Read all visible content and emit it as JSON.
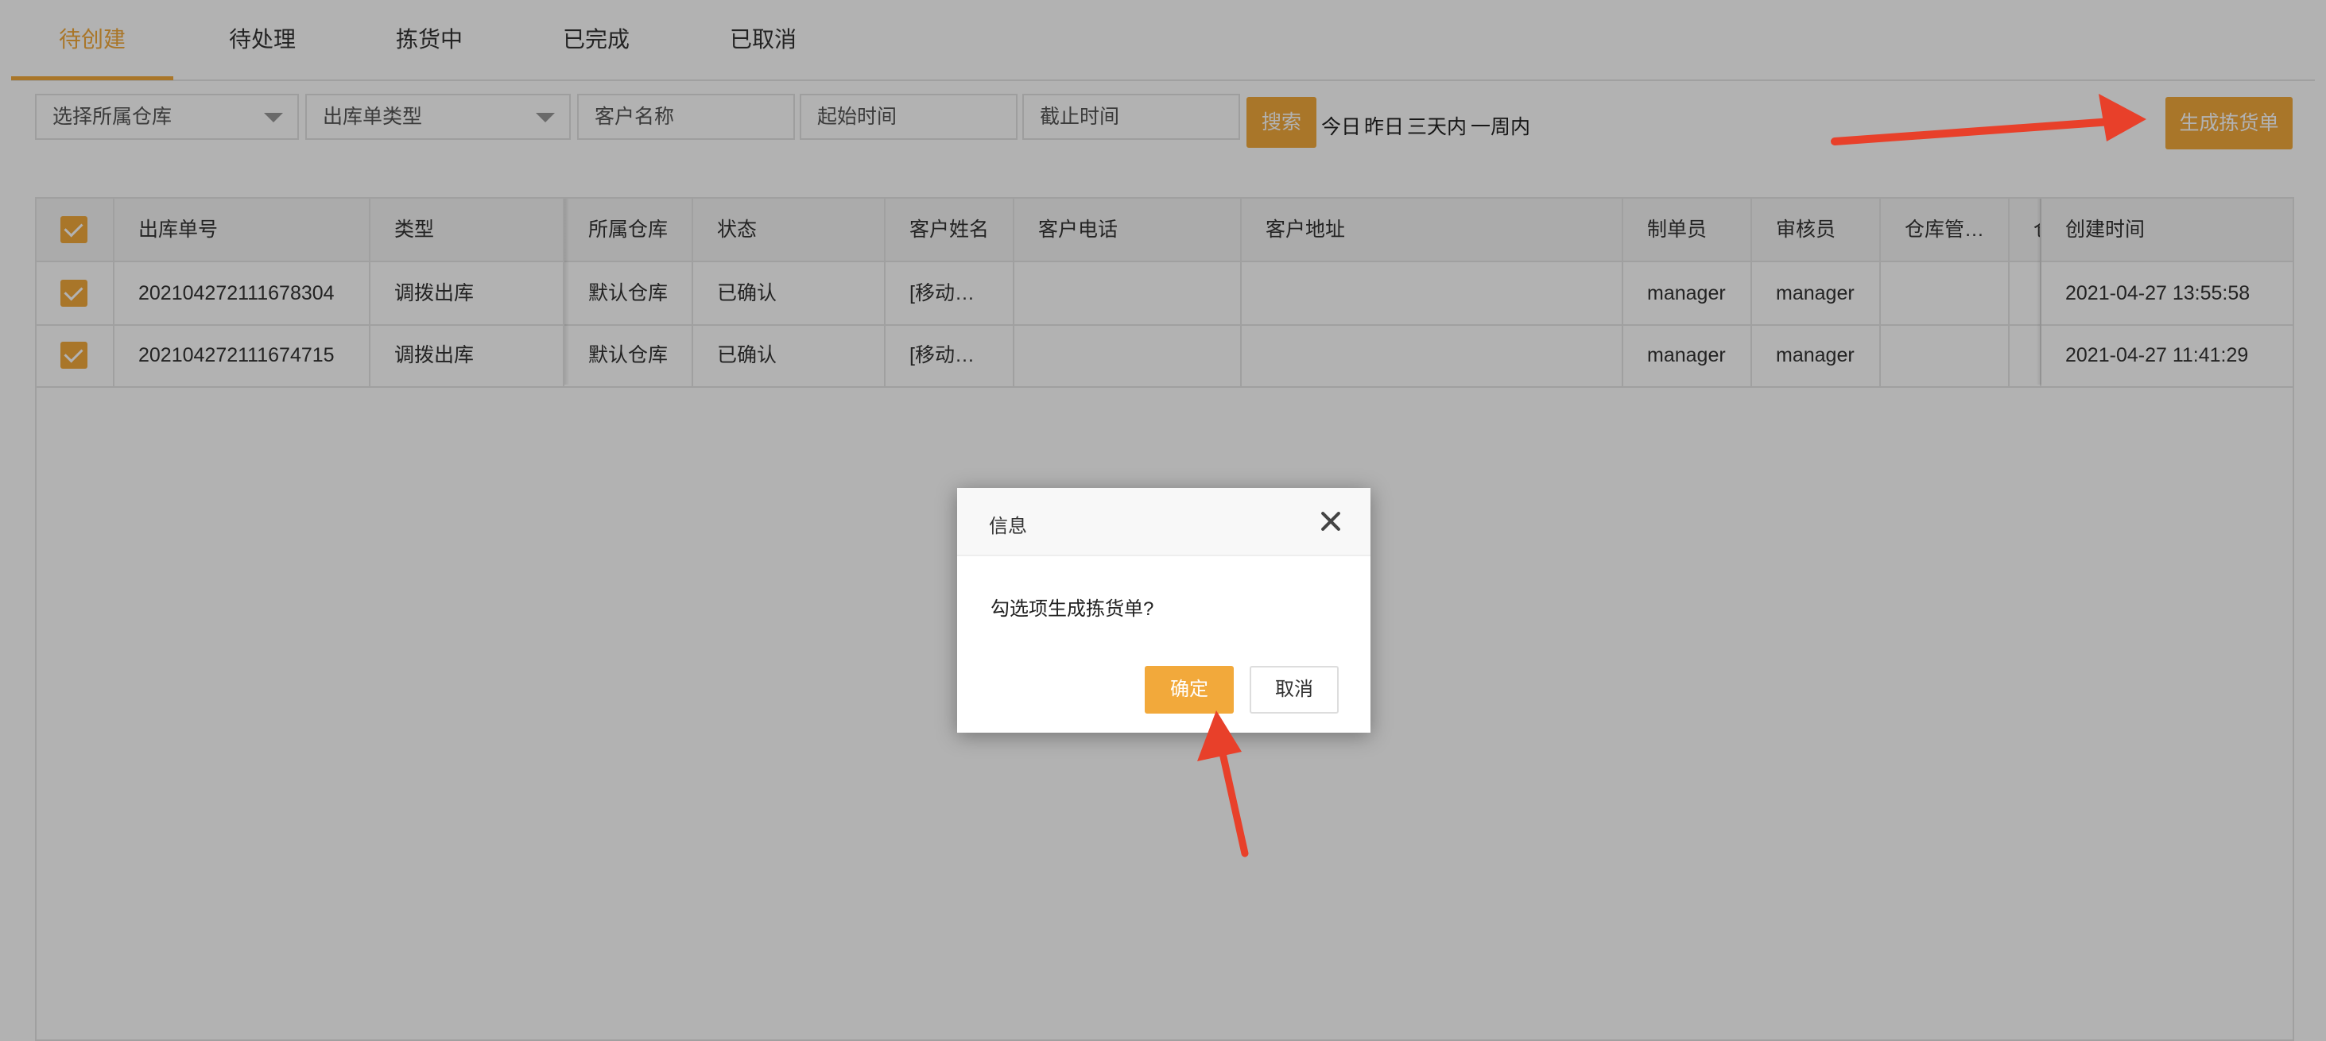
{
  "tabs": [
    "待创建",
    "待处理",
    "拣货中",
    "已完成",
    "已取消"
  ],
  "filters": {
    "warehouse_select": "选择所属仓库",
    "type_select": "出库单类型",
    "customer_placeholder": "客户名称",
    "start_time_placeholder": "起始时间",
    "end_time_placeholder": "截止时间",
    "search_label": "搜索",
    "quick_ranges": [
      "今日",
      "昨日",
      "三天内",
      "一周内"
    ]
  },
  "toolbar": {
    "generate_label": "生成拣货单"
  },
  "table": {
    "headers": [
      "出库单号",
      "类型",
      "所属仓库",
      "状态",
      "客户姓名",
      "客户电话",
      "客户地址",
      "制单员",
      "审核员",
      "仓库管…",
      "创建时间"
    ],
    "truncated_header": "仓",
    "rows": [
      {
        "checked": true,
        "cells": [
          "202104272111678304",
          "调拨出库",
          "默认仓库",
          "已确认",
          "[移动…",
          "",
          "",
          "manager",
          "manager",
          "",
          "2021-04-27 13:55:58"
        ]
      },
      {
        "checked": true,
        "cells": [
          "202104272111674715",
          "调拨出库",
          "默认仓库",
          "已确认",
          "[移动…",
          "",
          "",
          "manager",
          "manager",
          "",
          "2021-04-27 11:41:29"
        ]
      }
    ]
  },
  "dialog": {
    "title": "信息",
    "message": "勾选项生成拣货单?",
    "confirm_label": "确定",
    "cancel_label": "取消"
  },
  "colors": {
    "accent": "#f2a93b",
    "arrow": "#e8402a"
  }
}
